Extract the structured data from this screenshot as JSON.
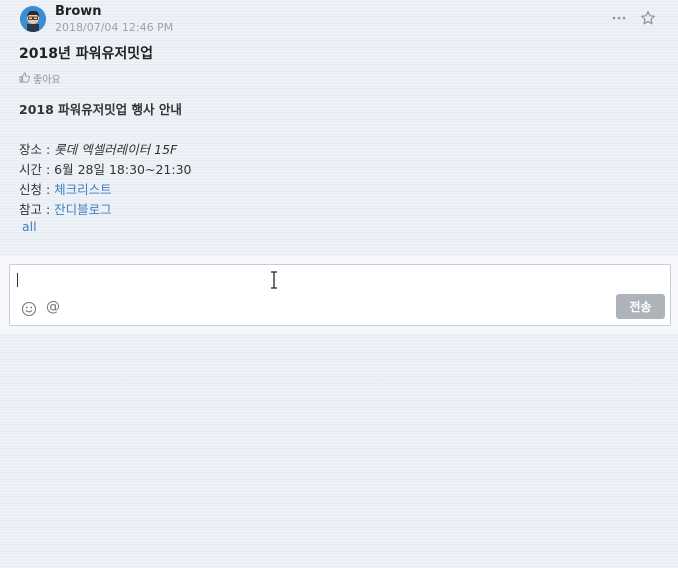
{
  "post": {
    "author": "Brown",
    "timestamp": "2018/07/04 12:46 PM",
    "title": "2018년 파워유저밋업",
    "like_label": "좋아요",
    "body": {
      "heading": "2018 파워유저밋업 행사 안내",
      "place_label": "장소 : ",
      "place_value": "롯데 엑셀러레이터 15F",
      "time_label": "시간 : ",
      "time_value": "6월 28일 18:30~21:30",
      "signup_label": "신청 : ",
      "signup_link": "체크리스트",
      "ref_label": "참고 : ",
      "ref_link": "잔디블로그",
      "tag": "all"
    },
    "icons": {
      "more": "more-horizontal-icon",
      "star": "star-icon",
      "like": "thumbs-up-icon"
    }
  },
  "composer": {
    "input_value": "",
    "send_label": "전송",
    "mention_symbol": "@",
    "icons": {
      "emoji": "smiley-icon",
      "mention": "at-icon"
    }
  },
  "colors": {
    "background": "#e9eef5",
    "link": "#3f7fc0",
    "send_button": "#aeb3b9",
    "avatar": "#3a8ed6"
  }
}
